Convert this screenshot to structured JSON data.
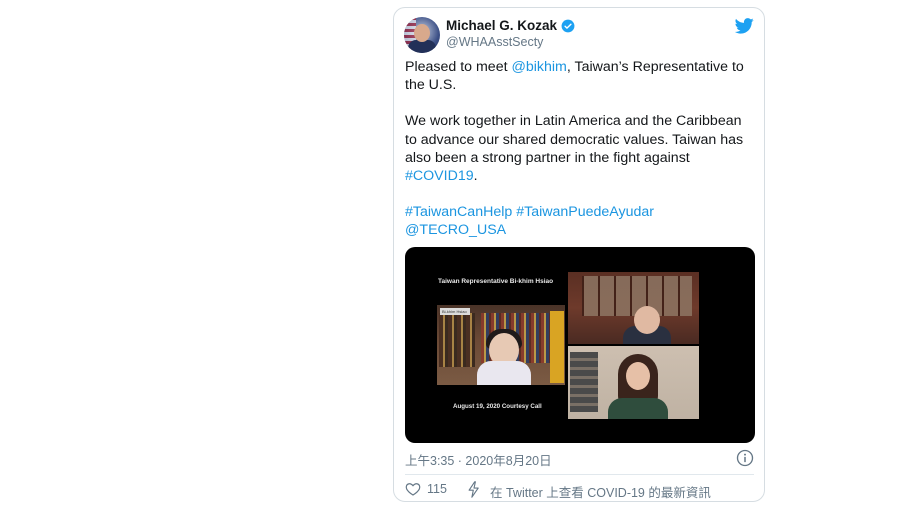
{
  "tweet": {
    "author_name": "Michael G. Kozak",
    "author_handle": "@WHAAsstSecty",
    "verified": true,
    "text_parts": {
      "p1_before": "Pleased to meet ",
      "p1_mention": "@bikhim",
      "p1_after": ", Taiwan’s Representative to the U.S.",
      "p2_before": "We work together in Latin America and the Caribbean to advance our shared democratic values. Taiwan has also been a strong partner in the fight against ",
      "p2_hashtag": "#COVID19",
      "p2_after": ".",
      "p3_hashtag1": "#TaiwanCanHelp",
      "p3_hashtag2": "#TaiwanPuedeAyudar",
      "p3_mention": "@TECRO_USA"
    },
    "media": {
      "video_title": "Taiwan Representative Bi-khim Hsiao",
      "caption": "August 19, 2020 Courtesy Call",
      "nametag": "Bi-khim Hsiao"
    },
    "timestamp": "上午3:35 · 2020年8月20日",
    "likes": "115",
    "covid_link": "在 Twitter 上查看 COVID-19 的最新資訊"
  },
  "colors": {
    "link": "#1b95e0",
    "secondary_text": "#657786",
    "border": "#d6dde2",
    "twitter_blue": "#1da1f2"
  },
  "icons": {
    "verified": "verified-badge-icon",
    "logo": "twitter-bird-icon",
    "info": "info-icon",
    "like": "heart-icon",
    "covid": "lightning-bolt-icon"
  }
}
